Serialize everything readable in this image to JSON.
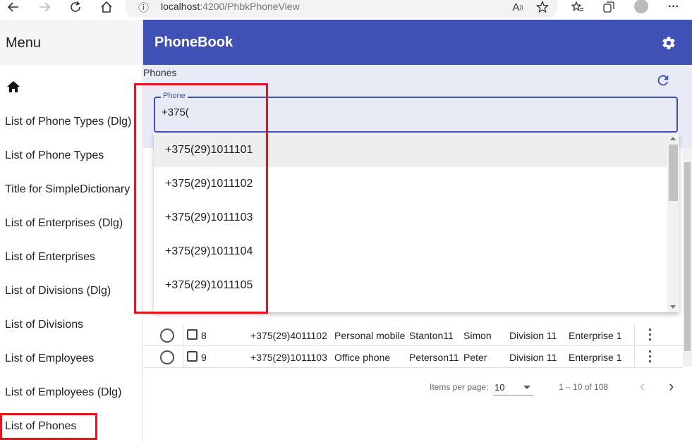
{
  "browser": {
    "url_host": "localhost",
    "url_rest": ":4200/PhbkPhoneView",
    "icons": [
      "back-icon",
      "forward-icon",
      "reload-icon",
      "home-icon",
      "info-icon",
      "read-aloud-icon",
      "favorite-add-icon",
      "favorites-icon",
      "collections-icon",
      "profile-icon",
      "more-icon"
    ]
  },
  "sidebar": {
    "title": "Menu",
    "items": [
      {
        "label": "List of Phone Types (Dlg)"
      },
      {
        "label": "List of Phone Types"
      },
      {
        "label": "Title for SimpleDictionary"
      },
      {
        "label": "List of Enterprises (Dlg)"
      },
      {
        "label": "List of Enterprises"
      },
      {
        "label": "List of Divisions (Dlg)"
      },
      {
        "label": "List of Divisions"
      },
      {
        "label": "List of Employees"
      },
      {
        "label": "List of Employees (Dlg)"
      },
      {
        "label": "List of Phones"
      }
    ]
  },
  "toolbar": {
    "title": "PhoneBook"
  },
  "panel": {
    "label": "Phones",
    "field_label": "Phone",
    "field_value": "+375("
  },
  "autocomplete": {
    "options": [
      "+375(29)1011101",
      "+375(29)1011102",
      "+375(29)1011103",
      "+375(29)1011104",
      "+375(29)1011105"
    ]
  },
  "table": {
    "rows": [
      {
        "id": "8",
        "phone": "+375(29)4011102",
        "type": "Personal mobile",
        "last": "Stanton11",
        "first": "Simon",
        "division": "Division 11",
        "enterprise": "Enterprise 1"
      },
      {
        "id": "9",
        "phone": "+375(29)1011103",
        "type": "Office phone",
        "last": "Peterson11",
        "first": "Peter",
        "division": "Division 11",
        "enterprise": "Enterprise 1"
      }
    ]
  },
  "paginator": {
    "items_per_page_label": "Items per page:",
    "page_size": "10",
    "range": "1 – 10 of 108"
  },
  "colors": {
    "primary": "#3f51b5",
    "panel_bg": "#e8eaf6",
    "highlight": "#e3131f"
  }
}
